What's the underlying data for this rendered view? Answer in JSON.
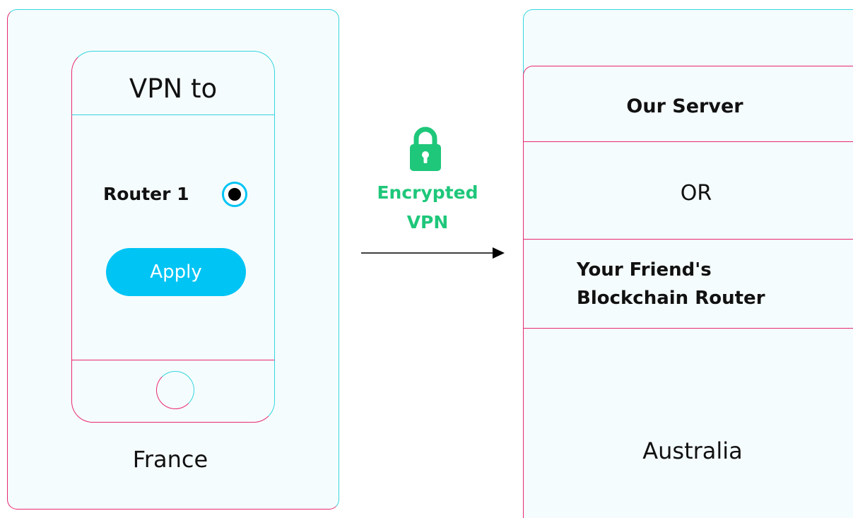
{
  "phone": {
    "title": "VPN to",
    "router_option": "Router 1",
    "router_selected": true,
    "apply_label": "Apply",
    "location": "France"
  },
  "connection": {
    "lock_icon": "lock-icon",
    "label_line1": "Encrypted",
    "label_line2": "VPN",
    "label_color": "#1ec77a"
  },
  "destination": {
    "option_server": "Our Server",
    "or_label": "OR",
    "option_friend_line1": "Your Friend's",
    "option_friend_line2": "Blockchain Router",
    "location": "Australia"
  },
  "colors": {
    "accent_button": "#00c4f4",
    "border_teal": "#35d6e0",
    "border_pink": "#e8286f",
    "panel_bg": "#f5fcfd"
  }
}
